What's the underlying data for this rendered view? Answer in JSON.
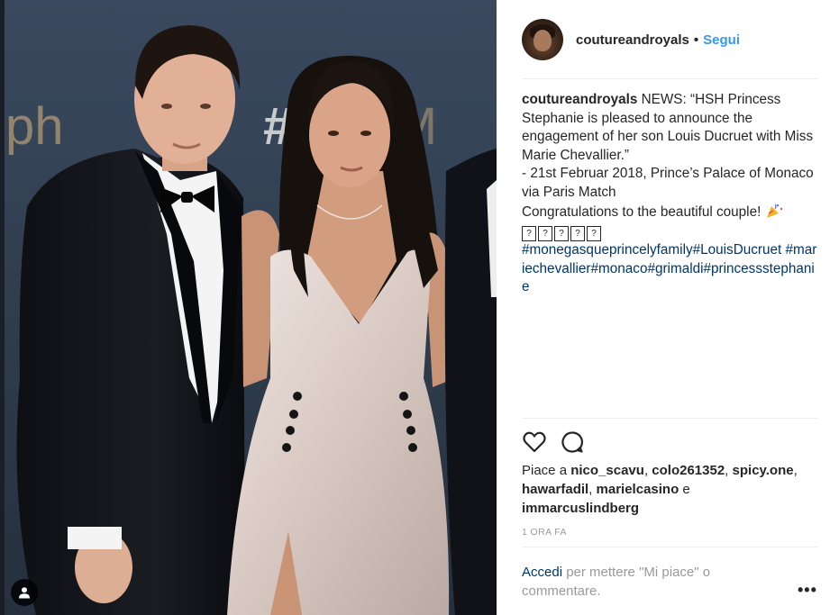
{
  "photo": {
    "backdrop_text": "#GoldenM",
    "backdrop_side_text": "ph"
  },
  "post": {
    "username": "coutureandroyals",
    "separator": "•",
    "follow_label": "Segui",
    "caption": {
      "username": "coutureandroyals",
      "lines": [
        "NEWS: “HSH Princess Stephanie is pleased to announce the engagement of her son Louis Ducruet with Miss Marie Chevallier.”",
        "- 21st Februar 2018, Prince’s Palace of Monaco via Paris Match",
        "Congratulations to the beautiful couple!"
      ],
      "hashtags": "#monegasqueprincelyfamily#LouisDucruet #mariechevallier#monaco#grimaldi#princessstephanie"
    },
    "likes": {
      "prefix": "Piace a",
      "names": [
        "nico_scavu",
        "colo261352",
        "spicy.one",
        "hawarfadil",
        "marielcasino"
      ],
      "conjunction": "e",
      "last_name": "immarcuslindberg"
    },
    "timestamp": "1 ORA FA",
    "login_prompt": {
      "link": "Accedi",
      "text": "per mettere \"Mi piace\" o commentare."
    },
    "more_label": "•••"
  },
  "icons": {
    "like": "heart-icon",
    "comment": "comment-icon",
    "tag": "user-tag-icon",
    "more": "more-options-icon"
  },
  "colors": {
    "link_blue": "#3897f0",
    "hashtag_blue": "#003569",
    "text": "#262626",
    "muted": "#999999"
  }
}
